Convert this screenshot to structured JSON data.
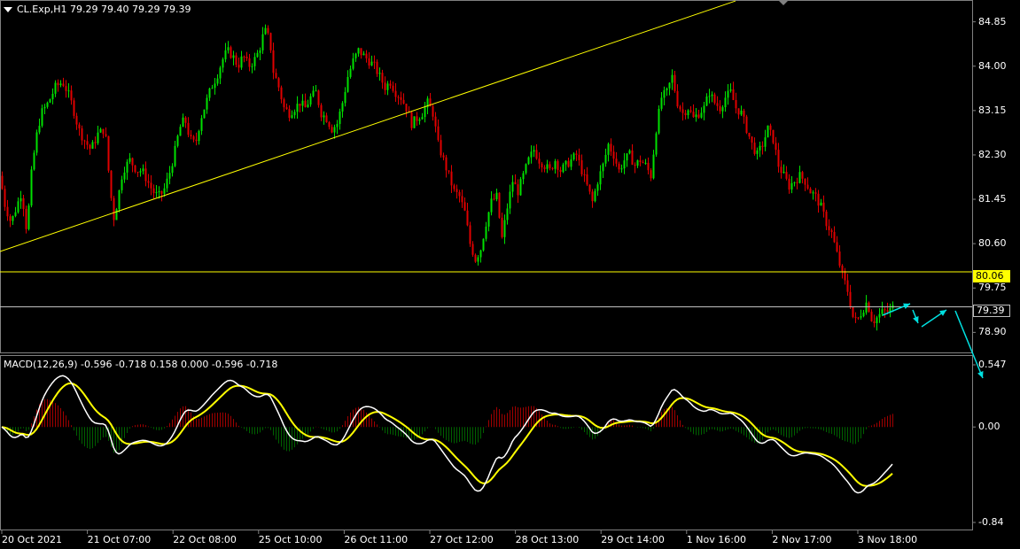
{
  "window": {
    "symbol_line": "CL.Exp,H1  79.29 79.40 79.29 79.39",
    "macd_line": "MACD(12,26,9) -0.596 -0.718 0.158 0.000 -0.596 -0.718"
  },
  "price_axis": {
    "labels": [
      "84.85",
      "84.00",
      "83.15",
      "82.30",
      "81.45",
      "80.60",
      "79.75",
      "78.90"
    ],
    "current_price": "79.39",
    "level_price": "80.06"
  },
  "macd_axis": {
    "labels": [
      "0.547",
      "0.00",
      "-0.84"
    ]
  },
  "time_axis": {
    "labels": [
      "20 Oct 2021",
      "21 Oct 07:00",
      "22 Oct 08:00",
      "25 Oct 10:00",
      "26 Oct 11:00",
      "27 Oct 12:00",
      "28 Oct 13:00",
      "29 Oct 14:00",
      "1 Nov 16:00",
      "2 Nov 17:00",
      "3 Nov 18:00"
    ]
  },
  "colors": {
    "bull": "#00e000",
    "bear": "#e00000",
    "trendline": "#ffff00",
    "level_line": "#ffff00",
    "current_line": "#c0c0c0",
    "arrow": "#00e0e0",
    "macd_main": "#ffffff",
    "macd_signal": "#ffff00",
    "hist_pos": "#a00000",
    "hist_neg": "#006000"
  },
  "chart_data": {
    "type": "candlestick",
    "symbol": "CL.Exp",
    "timeframe": "H1",
    "price_range": [
      78.55,
      85.2
    ],
    "last": {
      "open": 79.29,
      "high": 79.4,
      "low": 79.29,
      "close": 79.39
    },
    "levels": {
      "horizontal": 80.06,
      "current": 79.39
    },
    "close_path": [
      [
        0,
        81.9
      ],
      [
        4,
        81.4
      ],
      [
        8,
        81.2
      ],
      [
        12,
        81.0
      ],
      [
        18,
        81.3
      ],
      [
        24,
        81.6
      ],
      [
        30,
        80.8
      ],
      [
        34,
        81.8
      ],
      [
        40,
        82.6
      ],
      [
        46,
        83.1
      ],
      [
        54,
        83.3
      ],
      [
        62,
        83.6
      ],
      [
        70,
        83.7
      ],
      [
        76,
        83.5
      ],
      [
        82,
        83.2
      ],
      [
        88,
        82.8
      ],
      [
        94,
        82.6
      ],
      [
        102,
        82.4
      ],
      [
        110,
        82.7
      ],
      [
        118,
        82.8
      ],
      [
        124,
        81.6
      ],
      [
        128,
        81.1
      ],
      [
        132,
        81.4
      ],
      [
        138,
        82.0
      ],
      [
        146,
        82.2
      ],
      [
        154,
        82.0
      ],
      [
        160,
        82.0
      ],
      [
        166,
        81.8
      ],
      [
        172,
        81.6
      ],
      [
        178,
        81.5
      ],
      [
        184,
        81.6
      ],
      [
        190,
        81.9
      ],
      [
        196,
        82.3
      ],
      [
        202,
        82.8
      ],
      [
        208,
        83.0
      ],
      [
        214,
        82.6
      ],
      [
        220,
        82.5
      ],
      [
        226,
        83.0
      ],
      [
        232,
        83.3
      ],
      [
        238,
        83.6
      ],
      [
        244,
        83.8
      ],
      [
        250,
        84.1
      ],
      [
        256,
        84.3
      ],
      [
        262,
        84.2
      ],
      [
        268,
        84.0
      ],
      [
        274,
        84.2
      ],
      [
        280,
        84.0
      ],
      [
        286,
        84.1
      ],
      [
        292,
        84.3
      ],
      [
        298,
        84.7
      ],
      [
        304,
        84.5
      ],
      [
        308,
        83.9
      ],
      [
        314,
        83.6
      ],
      [
        320,
        83.2
      ],
      [
        326,
        83.1
      ],
      [
        332,
        83.2
      ],
      [
        338,
        83.3
      ],
      [
        344,
        83.2
      ],
      [
        350,
        83.4
      ],
      [
        356,
        83.5
      ],
      [
        362,
        83.1
      ],
      [
        368,
        83.0
      ],
      [
        374,
        82.8
      ],
      [
        380,
        82.9
      ],
      [
        386,
        83.3
      ],
      [
        392,
        83.8
      ],
      [
        398,
        84.1
      ],
      [
        404,
        84.3
      ],
      [
        410,
        84.2
      ],
      [
        416,
        84.1
      ],
      [
        422,
        84.0
      ],
      [
        428,
        83.8
      ],
      [
        434,
        83.6
      ],
      [
        440,
        83.7
      ],
      [
        446,
        83.5
      ],
      [
        452,
        83.4
      ],
      [
        458,
        83.2
      ],
      [
        464,
        82.9
      ],
      [
        470,
        83.0
      ],
      [
        476,
        83.1
      ],
      [
        482,
        83.3
      ],
      [
        488,
        83.1
      ],
      [
        494,
        82.5
      ],
      [
        500,
        82.2
      ],
      [
        506,
        81.9
      ],
      [
        512,
        81.6
      ],
      [
        518,
        81.5
      ],
      [
        524,
        81.2
      ],
      [
        530,
        80.6
      ],
      [
        536,
        80.3
      ],
      [
        542,
        80.5
      ],
      [
        548,
        81.0
      ],
      [
        554,
        81.4
      ],
      [
        560,
        81.5
      ],
      [
        566,
        80.7
      ],
      [
        572,
        81.3
      ],
      [
        578,
        81.8
      ],
      [
        584,
        81.6
      ],
      [
        590,
        81.9
      ],
      [
        596,
        82.2
      ],
      [
        602,
        82.4
      ],
      [
        608,
        82.2
      ],
      [
        614,
        82.1
      ],
      [
        620,
        82.0
      ],
      [
        626,
        82.2
      ],
      [
        632,
        82.0
      ],
      [
        638,
        82.1
      ],
      [
        644,
        82.2
      ],
      [
        650,
        82.3
      ],
      [
        656,
        82.0
      ],
      [
        662,
        81.7
      ],
      [
        668,
        81.4
      ],
      [
        674,
        81.8
      ],
      [
        680,
        82.1
      ],
      [
        686,
        82.5
      ],
      [
        692,
        82.3
      ],
      [
        698,
        82.0
      ],
      [
        704,
        82.2
      ],
      [
        710,
        82.3
      ],
      [
        716,
        82.1
      ],
      [
        722,
        82.2
      ],
      [
        728,
        82.1
      ],
      [
        734,
        81.9
      ],
      [
        740,
        82.8
      ],
      [
        746,
        83.4
      ],
      [
        752,
        83.5
      ],
      [
        758,
        83.8
      ],
      [
        764,
        83.3
      ],
      [
        770,
        83.1
      ],
      [
        776,
        83.2
      ],
      [
        782,
        83.0
      ],
      [
        788,
        83.1
      ],
      [
        794,
        83.2
      ],
      [
        800,
        83.5
      ],
      [
        806,
        83.3
      ],
      [
        812,
        83.2
      ],
      [
        818,
        83.4
      ],
      [
        824,
        83.5
      ],
      [
        830,
        83.2
      ],
      [
        836,
        83.1
      ],
      [
        842,
        82.8
      ],
      [
        848,
        82.5
      ],
      [
        854,
        82.3
      ],
      [
        860,
        82.5
      ],
      [
        866,
        82.8
      ],
      [
        872,
        82.6
      ],
      [
        878,
        82.1
      ],
      [
        884,
        81.9
      ],
      [
        890,
        81.7
      ],
      [
        896,
        81.8
      ],
      [
        902,
        81.9
      ],
      [
        908,
        81.8
      ],
      [
        914,
        81.6
      ],
      [
        920,
        81.5
      ],
      [
        926,
        81.3
      ],
      [
        932,
        81.0
      ],
      [
        938,
        80.8
      ],
      [
        944,
        80.4
      ],
      [
        950,
        80.0
      ],
      [
        956,
        79.7
      ],
      [
        962,
        79.2
      ],
      [
        966,
        79.1
      ],
      [
        972,
        79.3
      ],
      [
        978,
        79.5
      ],
      [
        984,
        79.1
      ],
      [
        990,
        79.2
      ],
      [
        996,
        79.3
      ],
      [
        1002,
        79.3
      ],
      [
        1008,
        79.39
      ]
    ],
    "trendline": [
      [
        0,
        80.45
      ],
      [
        830,
        85.25
      ]
    ],
    "macd": {
      "params": "12,26,9",
      "main": -0.596,
      "signal": -0.718,
      "range": [
        -0.84,
        0.547
      ]
    }
  }
}
